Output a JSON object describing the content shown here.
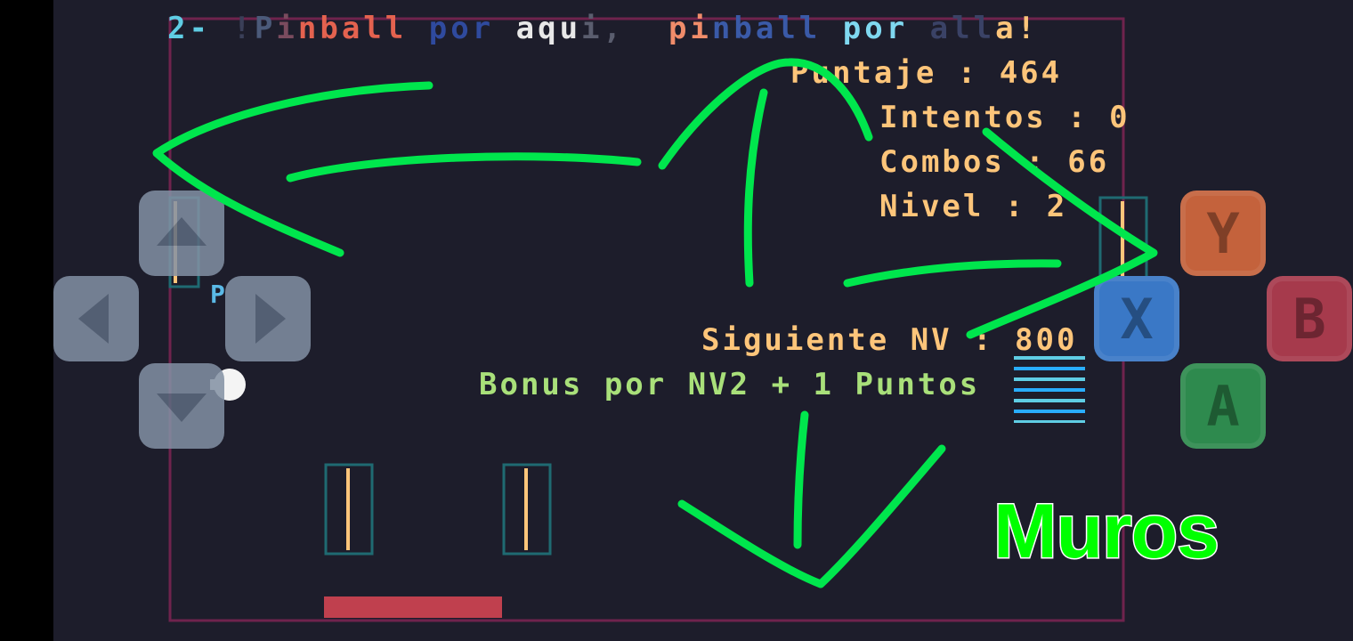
{
  "title": {
    "segments": [
      {
        "text": "2-",
        "color": "#5fcde4"
      },
      {
        "text": " !",
        "color": "#3a3f58"
      },
      {
        "text": "P",
        "color": "#4b5a7a"
      },
      {
        "text": "i",
        "color": "#7a4b5e"
      },
      {
        "text": "nball",
        "color": "#e4624f"
      },
      {
        "text": " ",
        "color": "#e4624f"
      },
      {
        "text": "por",
        "color": "#2f4a9e"
      },
      {
        "text": " ",
        "color": "#2f4a9e"
      },
      {
        "text": "aqu",
        "color": "#e8e8e8"
      },
      {
        "text": "i,",
        "color": "#5a5d6e"
      },
      {
        "text": "  ",
        "color": "#5a5d6e"
      },
      {
        "text": "pi",
        "color": "#f08c6a"
      },
      {
        "text": "nball",
        "color": "#3a5aa8"
      },
      {
        "text": " ",
        "color": "#3a5aa8"
      },
      {
        "text": "por",
        "color": "#7fd8f0"
      },
      {
        "text": " ",
        "color": "#7fd8f0"
      },
      {
        "text": "all",
        "color": "#3a4266"
      },
      {
        "text": "a!",
        "color": "#fdc57a"
      }
    ]
  },
  "hud": {
    "score": "Puntaje : 464",
    "tries": "Intentos : 0",
    "combos": "Combos : 66",
    "level": "Nivel : 2",
    "next_level": "Siguiente NV : 800",
    "bonus": "Bonus por NV2 + 1 Puntos"
  },
  "ball_label": "P",
  "annotation": "Muros",
  "dpad": {
    "up": "up-arrow-icon",
    "down": "down-arrow-icon",
    "left": "left-arrow-icon",
    "right": "right-arrow-icon"
  },
  "face_buttons": {
    "y": {
      "label": "Y",
      "color": "#c4623c"
    },
    "x": {
      "label": "X",
      "color": "#3a78c6"
    },
    "b": {
      "label": "B",
      "color": "#a63a4c"
    },
    "a": {
      "label": "A",
      "color": "#2e8a4e"
    }
  },
  "colors": {
    "background": "#1d1d2b",
    "border": "#7e2553",
    "wall_outline": "#1f6a72",
    "wall_core": "#fdc57a",
    "paddle": "#c0404e",
    "annotation_stroke": "#00e64d",
    "brick_stripe": "#5fcde4"
  }
}
